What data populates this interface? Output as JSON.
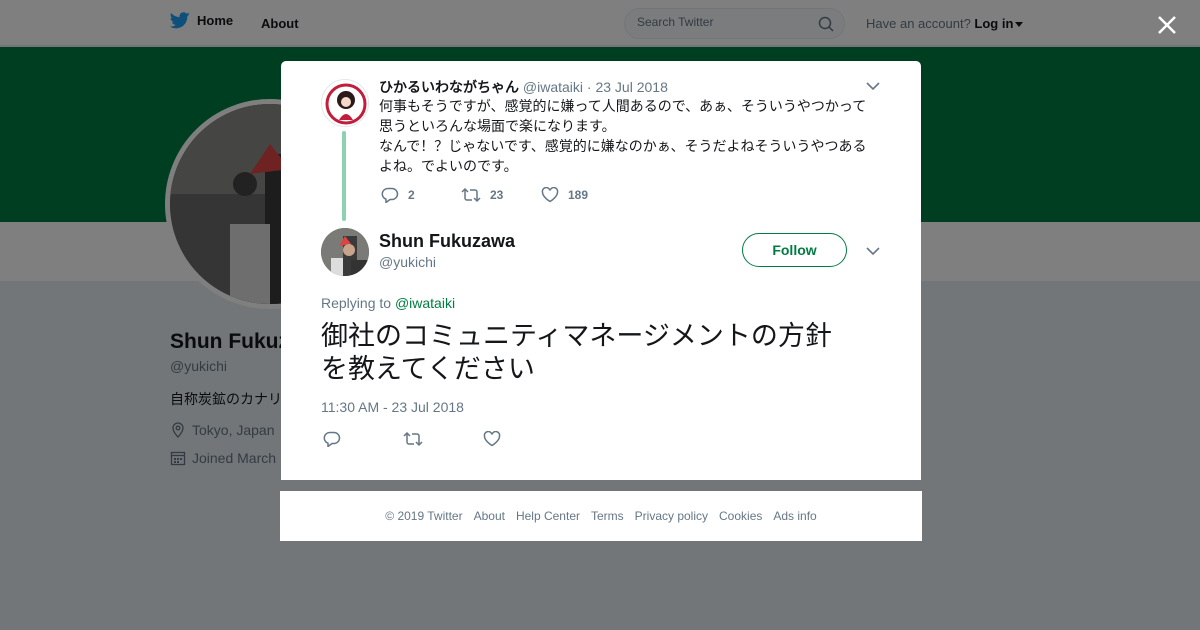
{
  "nav": {
    "home_label": "Home",
    "about_label": "About",
    "account_prompt": "Have an account?",
    "login_label": "Log in"
  },
  "search": {
    "placeholder": "Search Twitter"
  },
  "profile": {
    "name": "Shun Fukuzawa",
    "handle": "@yukichi",
    "bio": "自称炭鉱のカナリ",
    "location": "Tokyo, Japan",
    "joined": "Joined March"
  },
  "parent_tweet": {
    "author_name": "ひかるいわながちゃん",
    "author_handle": "@iwataiki",
    "dot": "·",
    "date": "23 Jul 2018",
    "text_line1": "何事もそうですが、感覚的に嫌って人間あるので、あぁ、そういうやつかって",
    "text_line2": "思うといろんな場面で楽になります。",
    "text_line3": "なんで！？じゃないです、感覚的に嫌なのかぁ、そうだよねそういうやつある",
    "text_line4": "よね。でよいのです。",
    "replies": "2",
    "retweets": "23",
    "likes": "189"
  },
  "main_tweet": {
    "author_name": "Shun Fukuzawa",
    "author_handle": "@yukichi",
    "follow_label": "Follow",
    "replying_prefix": "Replying to",
    "replying_to": "@iwataiki",
    "text_line1": "御社のコミュニティマネージメントの方針",
    "text_line2": "を教えてください",
    "timestamp": "11:30 AM - 23 Jul 2018"
  },
  "footer": {
    "links": [
      "© 2019 Twitter",
      "About",
      "Help Center",
      "Terms",
      "Privacy policy",
      "Cookies",
      "Ads info"
    ]
  },
  "colors": {
    "brand": "#1da1f2",
    "accent": "#007c42",
    "thread_line": "#8ed0b3"
  }
}
